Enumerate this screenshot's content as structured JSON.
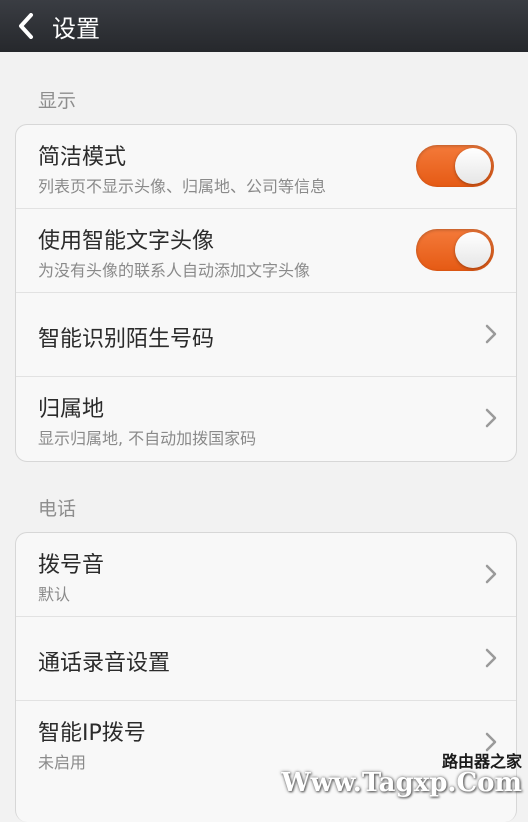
{
  "header": {
    "title": "设置",
    "back_icon": "back-arrow-icon"
  },
  "sections": [
    {
      "label": "显示",
      "items": [
        {
          "title": "简洁模式",
          "subtitle": "列表页不显示头像、归属地、公司等信息",
          "control": "toggle",
          "on": true
        },
        {
          "title": "使用智能文字头像",
          "subtitle": "为没有头像的联系人自动添加文字头像",
          "control": "toggle",
          "on": true
        },
        {
          "title": "智能识别陌生号码",
          "subtitle": "",
          "control": "chevron"
        },
        {
          "title": "归属地",
          "subtitle": "显示归属地, 不自动加拨国家码",
          "control": "chevron"
        }
      ]
    },
    {
      "label": "电话",
      "items": [
        {
          "title": "拨号音",
          "subtitle": "默认",
          "control": "chevron"
        },
        {
          "title": "通话录音设置",
          "subtitle": "",
          "control": "chevron"
        },
        {
          "title": "智能IP拨号",
          "subtitle": "未启用",
          "control": "chevron"
        }
      ]
    }
  ],
  "watermark": {
    "line1": "路由器之家",
    "line2": "Www.Tagxp.Com"
  },
  "colors": {
    "toggle_on": "#ee6a26",
    "titlebar": "#2e3035",
    "background": "#f2f2f2"
  }
}
